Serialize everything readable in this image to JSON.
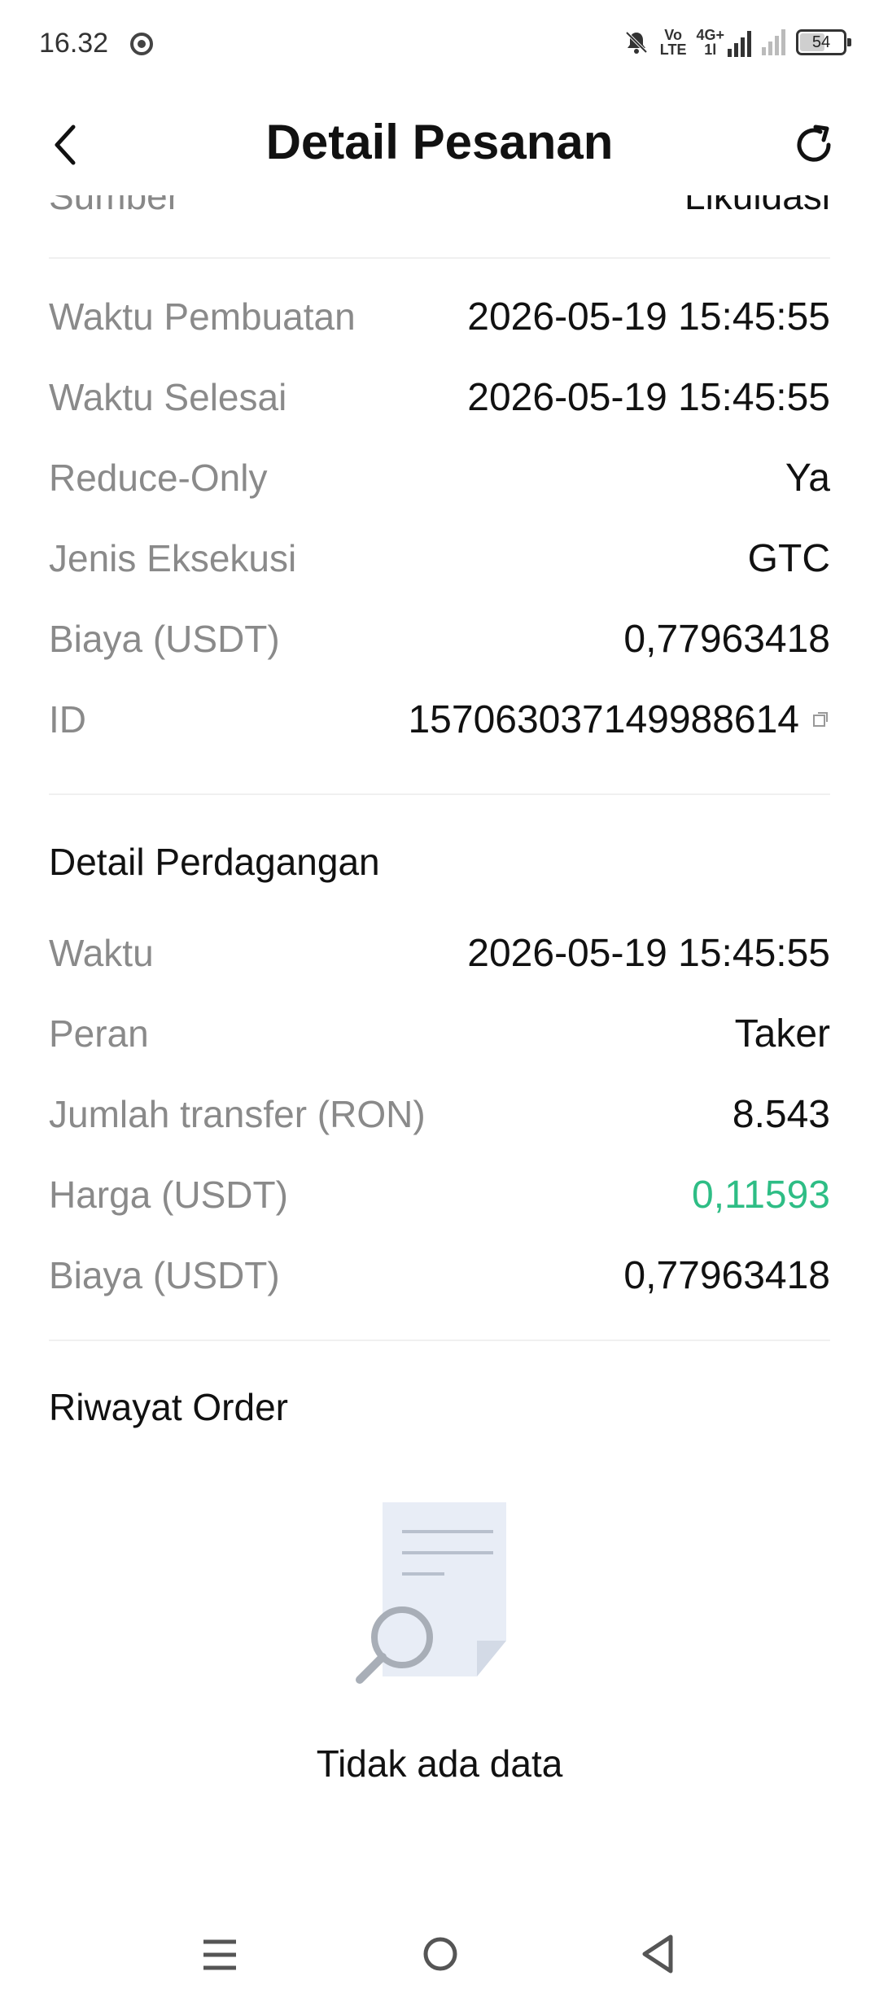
{
  "status_bar": {
    "time": "16.32",
    "network_top": "Vo",
    "network_bottom": "LTE",
    "signal_label_top": "4G+",
    "signal_label_bottom": "1l",
    "battery": "54"
  },
  "header": {
    "title": "Detail Pesanan"
  },
  "partial_row": {
    "label": "Sumber",
    "value": "Likuidasi"
  },
  "order_info": [
    {
      "label": "Waktu Pembuatan",
      "value": "2026-05-19 15:45:55"
    },
    {
      "label": "Waktu Selesai",
      "value": "2026-05-19 15:45:55"
    },
    {
      "label": "Reduce-Only",
      "value": "Ya"
    },
    {
      "label": "Jenis Eksekusi",
      "value": "GTC"
    },
    {
      "label": "Biaya (USDT)",
      "value": "0,77963418"
    },
    {
      "label": "ID",
      "value": "1570630371499886​14"
    }
  ],
  "trade_detail": {
    "title": "Detail Perdagangan",
    "rows": [
      {
        "label": "Waktu",
        "value": "2026-05-19 15:45:55"
      },
      {
        "label": "Peran",
        "value": "Taker"
      },
      {
        "label": "Jumlah transfer (RON)",
        "value": "8.543"
      },
      {
        "label": "Harga (USDT)",
        "value": "0,11593"
      },
      {
        "label": "Biaya (USDT)",
        "value": "0,77963418"
      }
    ]
  },
  "order_history": {
    "title": "Riwayat Order",
    "empty_text": "Tidak ada data"
  },
  "colors": {
    "price_green": "#2ebd85",
    "label_gray": "#8a8a8a"
  },
  "icons": {
    "back": "chevron-left-icon",
    "refresh": "refresh-icon",
    "copy": "copy-icon",
    "empty": "document-search-icon"
  }
}
